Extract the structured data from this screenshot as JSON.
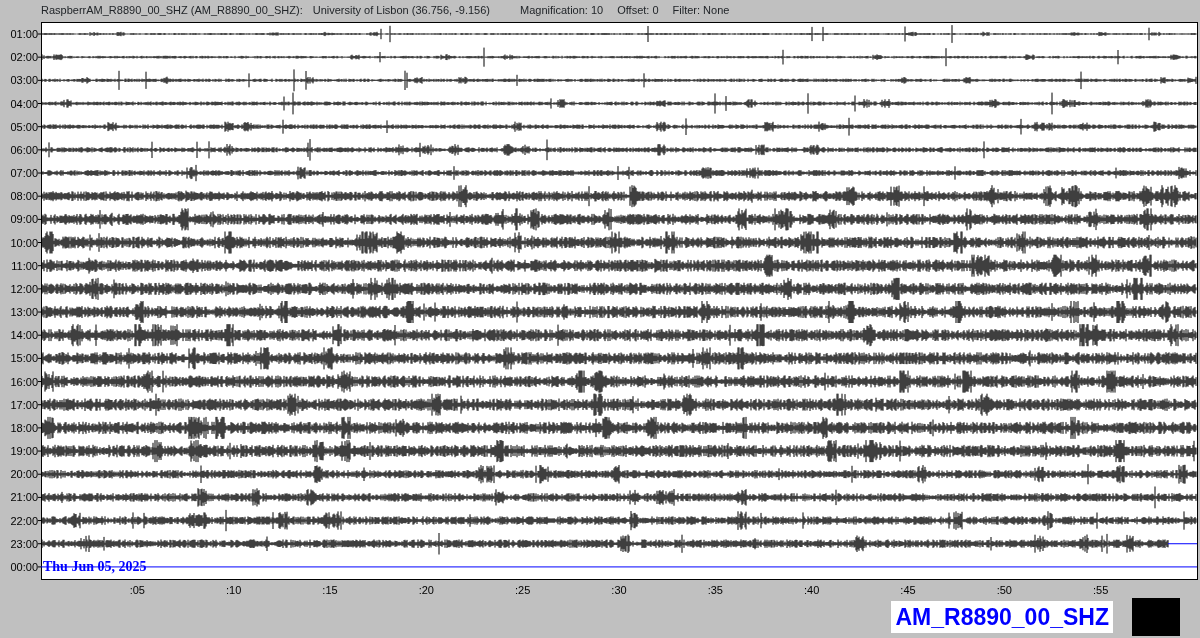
{
  "header": {
    "station": "RaspberrAM_R8890_00_SHZ (AM_R8890_00_SHZ):",
    "location": "University of Lisbon (36.756, -9.156)",
    "magnification": "Magnification: 10",
    "offset": "Offset: 0",
    "filter": "Filter: None"
  },
  "rows": [
    {
      "label": "01:00",
      "kind": "full"
    },
    {
      "label": "02:00",
      "kind": "full"
    },
    {
      "label": "03:00",
      "kind": "full"
    },
    {
      "label": "04:00",
      "kind": "full"
    },
    {
      "label": "05:00",
      "kind": "full"
    },
    {
      "label": "06:00",
      "kind": "full"
    },
    {
      "label": "07:00",
      "kind": "full"
    },
    {
      "label": "08:00",
      "kind": "full"
    },
    {
      "label": "09:00",
      "kind": "full"
    },
    {
      "label": "10:00",
      "kind": "full"
    },
    {
      "label": "11:00",
      "kind": "full"
    },
    {
      "label": "12:00",
      "kind": "full"
    },
    {
      "label": "13:00",
      "kind": "full"
    },
    {
      "label": "14:00",
      "kind": "full"
    },
    {
      "label": "15:00",
      "kind": "full"
    },
    {
      "label": "16:00",
      "kind": "full"
    },
    {
      "label": "17:00",
      "kind": "full"
    },
    {
      "label": "18:00",
      "kind": "full"
    },
    {
      "label": "19:00",
      "kind": "full"
    },
    {
      "label": "20:00",
      "kind": "full"
    },
    {
      "label": "21:00",
      "kind": "full"
    },
    {
      "label": "22:00",
      "kind": "full"
    },
    {
      "label": "23:00",
      "kind": "partial"
    },
    {
      "label": "00:00",
      "kind": "current",
      "date": "Thu Jun 05, 2025"
    }
  ],
  "x_ticks": [
    ":05",
    ":10",
    ":15",
    ":20",
    ":25",
    ":30",
    ":35",
    ":40",
    ":45",
    ":50",
    ":55"
  ],
  "station_label": "AM_R8890_00_SHZ"
}
